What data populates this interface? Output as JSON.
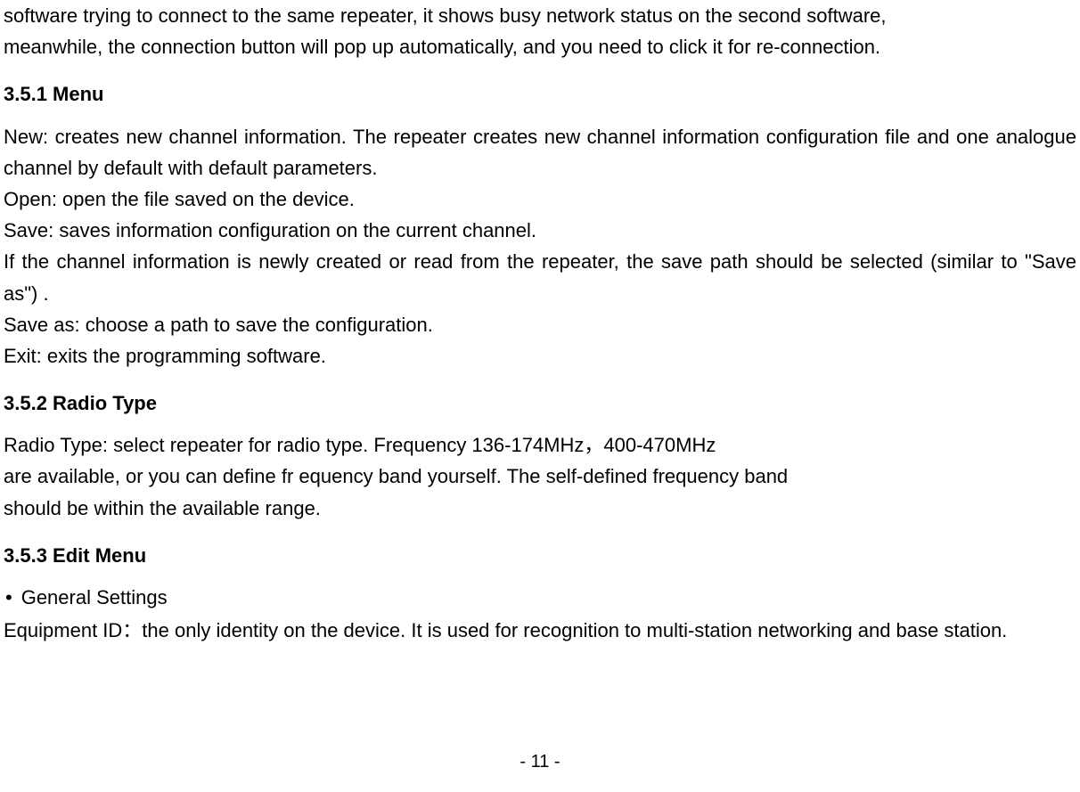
{
  "intro": {
    "line1": "software trying to connect to the same repeater, it shows busy network status on the second software,",
    "line2": "meanwhile, the connection button will pop up automatically, and you need to click it for re-connection."
  },
  "sec351": {
    "heading": "3.5.1 Menu",
    "p1": "New: creates new channel information. The repeater creates new channel information configuration file and one analogue channel by default with default parameters.",
    "p2": "Open: open the file saved on the device.",
    "p3": "Save: saves information configuration on the current channel.",
    "p4": "If the channel information is newly created or read from the repeater, the save path should be selected (similar to \"Save as\") .",
    "p5": "Save as: choose a path to save the configuration.",
    "p6": "Exit: exits the programming software."
  },
  "sec352": {
    "heading": "3.5.2 Radio Type",
    "p1": "Radio Type: select repeater for radio type. Frequency 136-174MHz，400-470MHz",
    "p2": " are available, or you can define fr equency band yourself. The self-defined frequency band",
    "p3": "should be within the available range."
  },
  "sec353": {
    "heading": "3.5.3 Edit Menu",
    "bullet1": "General Settings",
    "p1": "Equipment ID：the only identity on the device. It is used for recognition to multi-station networking and base station."
  },
  "footer": {
    "page": "- 11 -"
  }
}
